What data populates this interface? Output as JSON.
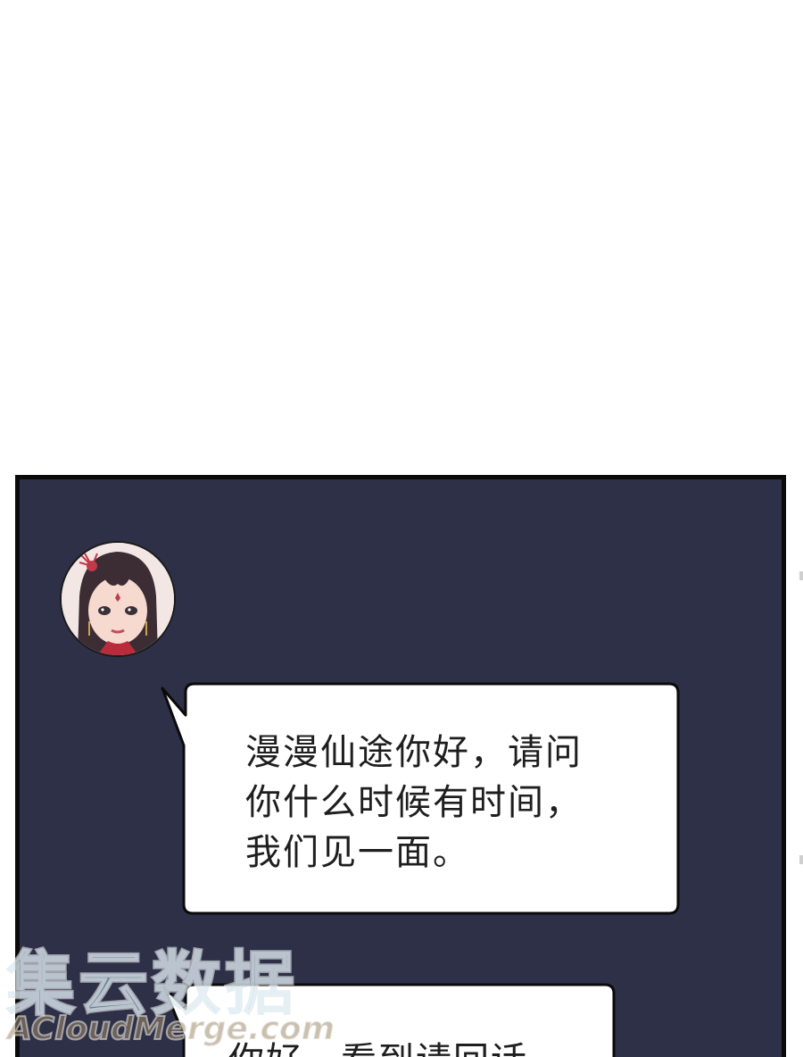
{
  "chat": {
    "messages": [
      {
        "text": "漫漫仙途你好，请问\n你什么时候有时间，\n我们见一面。"
      },
      {
        "text": "你好，看到请回话"
      }
    ]
  },
  "watermark": {
    "cn": "集云数据",
    "en": "ACloudMerge.com"
  },
  "colors": {
    "panel_bg": "#2d3046",
    "bubble_bg": "#ffffff",
    "border": "#0a0a0a"
  }
}
